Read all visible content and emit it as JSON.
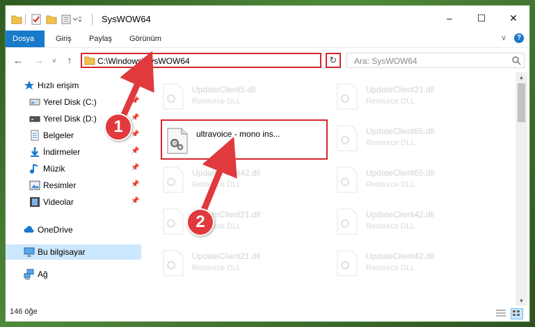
{
  "window": {
    "title": "SysWOW64",
    "controls": {
      "minimize": "–",
      "maximize": "☐",
      "close": "✕"
    }
  },
  "ribbon": {
    "tabs": [
      {
        "label": "Dosya",
        "active": true
      },
      {
        "label": "Giriş",
        "active": false
      },
      {
        "label": "Paylaş",
        "active": false
      },
      {
        "label": "Görünüm",
        "active": false
      }
    ],
    "expand_glyph": "∨",
    "help_glyph": "?"
  },
  "nav": {
    "back": "←",
    "forward": "→",
    "recent": "∨",
    "up": "↑",
    "address": "C:\\Windows\\SysWOW64",
    "address_dropdown": "∨",
    "refresh": "↻",
    "search_placeholder": "Ara: SysWOW64"
  },
  "sidebar": {
    "items": [
      {
        "label": "Hızlı erişim",
        "icon": "star-icon",
        "pinned": false
      },
      {
        "label": "Yerel Disk (C:)",
        "icon": "drive-icon",
        "pinned": true
      },
      {
        "label": "Yerel Disk (D:)",
        "icon": "drive-icon",
        "pinned": true
      },
      {
        "label": "Belgeler",
        "icon": "documents-icon",
        "pinned": true
      },
      {
        "label": "İndirmeler",
        "icon": "download-icon",
        "pinned": true
      },
      {
        "label": "Müzik",
        "icon": "music-icon",
        "pinned": true
      },
      {
        "label": "Resimler",
        "icon": "pictures-icon",
        "pinned": true
      },
      {
        "label": "Videolar",
        "icon": "video-icon",
        "pinned": true
      },
      {
        "label": "OneDrive",
        "icon": "cloud-icon",
        "pinned": false
      },
      {
        "label": "Bu bilgisayar",
        "icon": "computer-icon",
        "pinned": false,
        "selected": true
      },
      {
        "label": "Ağ",
        "icon": "network-icon",
        "pinned": false
      }
    ],
    "pin_glyph": "📌"
  },
  "files": {
    "highlighted": {
      "name": "ultravoice - mono ins...",
      "type": ""
    },
    "background": [
      {
        "name": "UpdateClient5.dll",
        "type": "Resource DLL"
      },
      {
        "name": "UpdateClient21.dll",
        "type": "Resource DLL"
      },
      {
        "name": "UpdateClient65.dll",
        "type": "Resource DLL"
      },
      {
        "name": "UpdateClient42.dll",
        "type": "Resource DLL"
      },
      {
        "name": "UpdateClient65.dll",
        "type": "Resource DLL"
      },
      {
        "name": "UpdateClient21.dll",
        "type": "Resource DLL"
      },
      {
        "name": "UpdateClient42.dll",
        "type": "Resource DLL"
      },
      {
        "name": "UpdateClient21.dll",
        "type": "Resource DLL"
      },
      {
        "name": "UpdateClient42.dll",
        "type": "Resource DLL"
      }
    ]
  },
  "status": {
    "count": "146 öğe"
  },
  "annotations": {
    "step1": "1",
    "step2": "2"
  },
  "colors": {
    "accent": "#1979ca",
    "highlight": "#d4262c",
    "callout": "#e0393e",
    "selected": "#cce8ff"
  }
}
